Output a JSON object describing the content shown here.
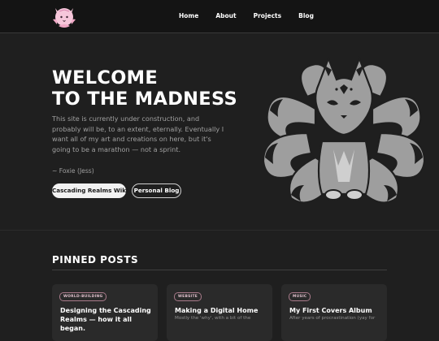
{
  "nav": {
    "items": [
      {
        "label": "Home"
      },
      {
        "label": "About"
      },
      {
        "label": "Projects"
      },
      {
        "label": "Blog"
      }
    ]
  },
  "hero": {
    "title_line1": "WELCOME",
    "title_line2": "TO THE MADNESS",
    "description": "This site is currently under construction, and probably will be, to an extent, eternally. Eventually I want all of my art and creations on here, but it's going to be a marathon — not a sprint.",
    "signature": "~ Foxie (Jess)",
    "primary_button": "Cascading Realms Wiki",
    "secondary_button": "Personal Blog"
  },
  "pinned": {
    "title": "PINNED POSTS",
    "posts": [
      {
        "tag": "WORLD-BUILDING",
        "title": "Designing the Cascading Realms — how it all began.",
        "excerpt": ""
      },
      {
        "tag": "WEBSITE",
        "title": "Making a Digital Home",
        "excerpt": "Mostly the 'why', with a bit of the"
      },
      {
        "tag": "MUSIC",
        "title": "My First Covers Album",
        "excerpt": "After years of procrastination (yay for"
      }
    ]
  },
  "colors": {
    "background": "#1f1f1f",
    "topbar": "#141414",
    "accent_tag_border": "#a87a8a",
    "fox_fill": "#9e9e9e"
  }
}
